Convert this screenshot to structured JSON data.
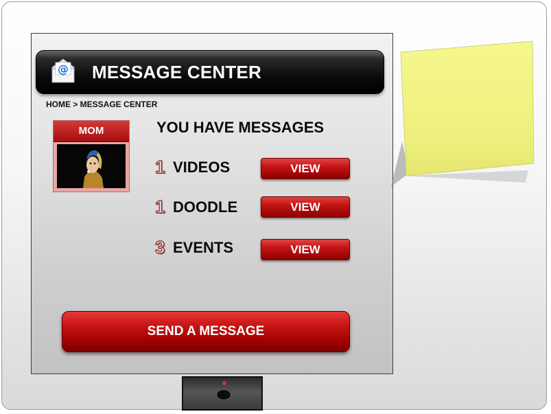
{
  "header": {
    "title": "MESSAGE CENTER",
    "icon": "mail-at-icon"
  },
  "breadcrumb": "HOME > MESSAGE CENTER",
  "contact": {
    "name": "MOM",
    "photo": "portrait-photo"
  },
  "messages": {
    "title": "YOU HAVE MESSAGES",
    "items": [
      {
        "count": "1",
        "label": "VIDEOS",
        "action": "VIEW"
      },
      {
        "count": "1",
        "label": "DOODLE",
        "action": "VIEW"
      },
      {
        "count": "3",
        "label": "EVENTS",
        "action": "VIEW"
      }
    ]
  },
  "send_button": "SEND A MESSAGE",
  "colors": {
    "accent_red": "#c41414",
    "header_black": "#0b0b0b",
    "sticky_yellow": "#f3f58a",
    "panel_gray": "#d6d6d6"
  }
}
